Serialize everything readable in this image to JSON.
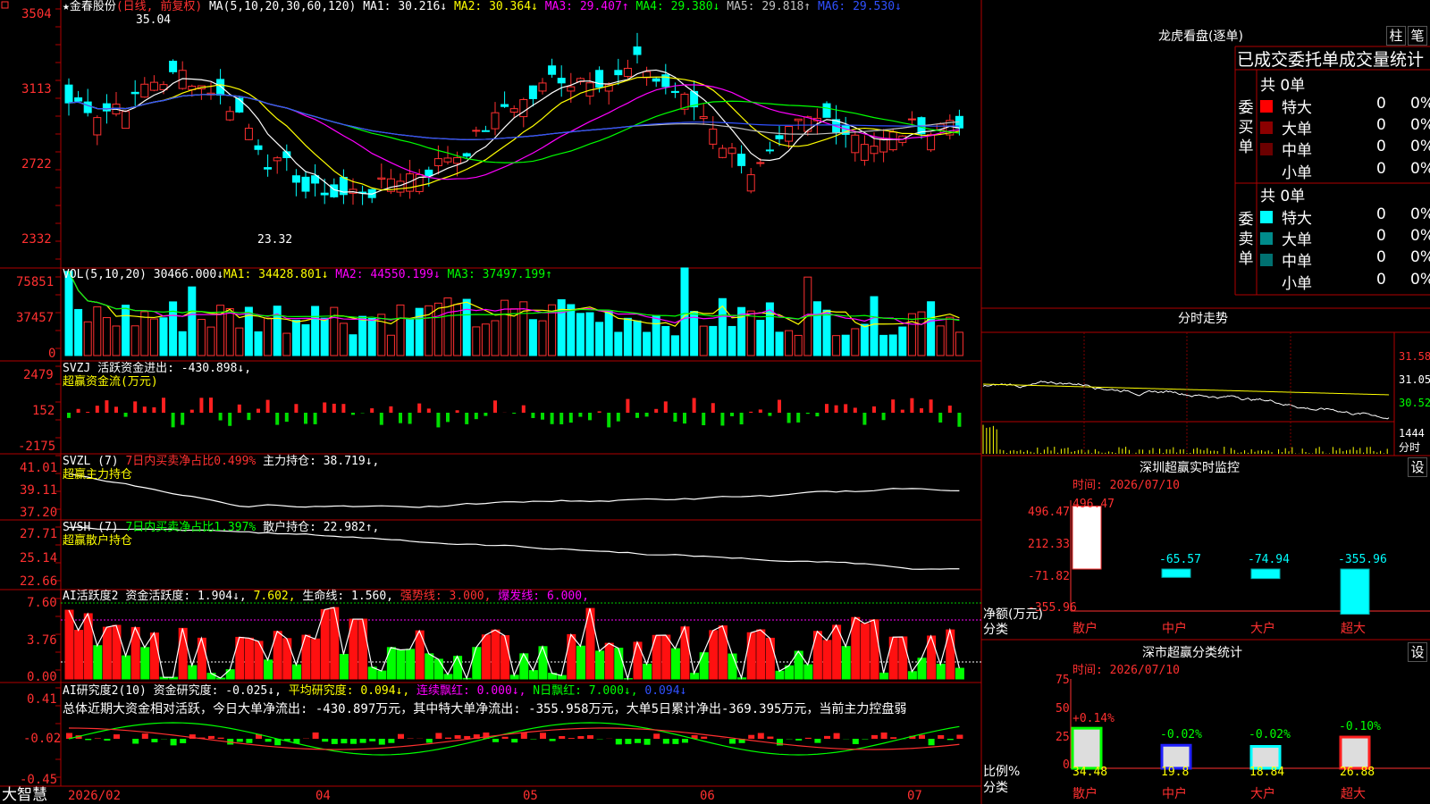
{
  "colors": {
    "up": "#ff3030",
    "down": "#00ffff",
    "ma1": "#ffffff",
    "ma2": "#ffff00",
    "ma3": "#ff00ff",
    "ma4": "#00ff00",
    "ma5": "#c0c0c0",
    "ma6": "#0000ff",
    "grid": "#b00000",
    "axis": "#ff3030"
  },
  "main": {
    "title_star": "★",
    "stock_name": "金春股份",
    "period": "(日线, 前复权)",
    "ma_label": "MA(5,10,20,30,60,120)",
    "ma1": "MA1: 30.216↓",
    "ma2": "MA2: 30.364↓",
    "ma3": "MA3: 29.407↑",
    "ma4": "MA4: 29.380↓",
    "ma5": "MA5: 29.818↑",
    "ma6": "MA6: 29.530↓",
    "high_mark": "35.04",
    "low_mark": "23.32",
    "y_ticks": [
      "3504",
      "3113",
      "2722",
      "2332"
    ]
  },
  "vol": {
    "label": "VOL(5,10,20)",
    "value": "30466.000↓",
    "ma1": "MA1: 34428.801↓",
    "ma2": "MA2: 44550.199↓",
    "ma3": "MA3: 37497.199↑",
    "y_ticks": [
      "75851",
      "37457",
      "0"
    ]
  },
  "svzj": {
    "label": "SVZJ",
    "desc": "活跃资金进出: -430.898↓,",
    "sub": "超赢资金流(万元)",
    "y_ticks": [
      "2479",
      "152",
      "-2175"
    ]
  },
  "svzl": {
    "label": "SVZL (7)",
    "desc": "7日内买卖净占比0.499%",
    "hold": "主力持仓: 38.719↓,",
    "sub": "超赢主力持仓",
    "y_ticks": [
      "41.01",
      "39.11",
      "37.20"
    ]
  },
  "svsh": {
    "label": "SVSH (7)",
    "desc": "7日内买卖净占比1.397%",
    "hold": "散户持仓: 22.982↑,",
    "sub": "超赢散户持仓",
    "y_ticks": [
      "27.71",
      "25.14",
      "22.66"
    ]
  },
  "ai1": {
    "label": "AI活跃度2",
    "a": "资金活跃度: 1.904↓,",
    "b": "7.602,",
    "c": "生命线: 1.560,",
    "d": "强势线: 3.000,",
    "e": "爆发线: 6.000,",
    "y_ticks": [
      "7.60",
      "3.76",
      "0.00"
    ]
  },
  "ai2": {
    "label": "AI研究度2(10)",
    "a": "资金研究度: -0.025↓,",
    "b": "平均研究度: 0.094↓,",
    "c": "连续飘红: 0.000↓,",
    "d": "N日飘红: 7.000↓,",
    "e": "0.094↓",
    "comment": "总体近期大资金相对活跃，今日大单净流出: -430.897万元，其中特大单净流出: -355.958万元，大单5日累计净出-369.395万元，当前主力控盘弱",
    "y_ticks": [
      "0.41",
      "-0.02",
      "-0.45"
    ]
  },
  "xaxis": {
    "brand": "大智慧",
    "labels": [
      "2026/02",
      "04",
      "05",
      "06",
      "07"
    ]
  },
  "right": {
    "lhb_title": "龙虎看盘(逐单)",
    "btn_zhu": "柱",
    "btn_bi": "笔",
    "table_header": "已成交委托单成交量统计",
    "buy_side": "委买单",
    "sell_side": "委卖单",
    "buy_total": "共 0单",
    "sell_total": "共 0单",
    "buy_rows": [
      {
        "name": "特大",
        "v": "0",
        "p": "0%"
      },
      {
        "name": "大单",
        "v": "0",
        "p": "0%"
      },
      {
        "name": "中单",
        "v": "0",
        "p": "0%"
      },
      {
        "name": "小单",
        "v": "0",
        "p": "0%"
      }
    ],
    "sell_rows": [
      {
        "name": "特大",
        "v": "0",
        "p": "0%"
      },
      {
        "name": "大单",
        "v": "0",
        "p": "0%"
      },
      {
        "name": "中单",
        "v": "0",
        "p": "0%"
      },
      {
        "name": "小单",
        "v": "0",
        "p": "0%"
      }
    ],
    "intraday_title": "分时走势",
    "intraday_ticks": [
      "31.58",
      "31.05",
      "30.52",
      "1444",
      "分时"
    ],
    "sz_title": "深圳超赢实时监控",
    "sz_set": "设",
    "sz_time": "时间: 2026/07/10",
    "sz_y": [
      "496.47",
      "212.33",
      "-71.82",
      "-355.96"
    ],
    "sz_bars": [
      {
        "cat": "散户",
        "val": 496.47,
        "label": "496.47"
      },
      {
        "cat": "中户",
        "val": -65.57,
        "label": "-65.57"
      },
      {
        "cat": "大户",
        "val": -74.94,
        "label": "-74.94"
      },
      {
        "cat": "超大",
        "val": -355.96,
        "label": "-355.96"
      }
    ],
    "sz_ylabel": "净额(万元)",
    "sz_xlabel": "分类",
    "sm_title": "深市超赢分类统计",
    "sm_set": "设",
    "sm_time": "时间: 2026/07/10",
    "sm_y": [
      "75",
      "50",
      "25",
      "0"
    ],
    "sm_bars": [
      {
        "cat": "散户",
        "val": 34.48,
        "chg": "+0.14%"
      },
      {
        "cat": "中户",
        "val": 19.8,
        "chg": "-0.02%"
      },
      {
        "cat": "大户",
        "val": 18.84,
        "chg": "-0.02%"
      },
      {
        "cat": "超大",
        "val": 26.88,
        "chg": "-0.10%"
      }
    ],
    "sm_ylabel": "比例%",
    "sm_xlabel": "分类"
  }
}
